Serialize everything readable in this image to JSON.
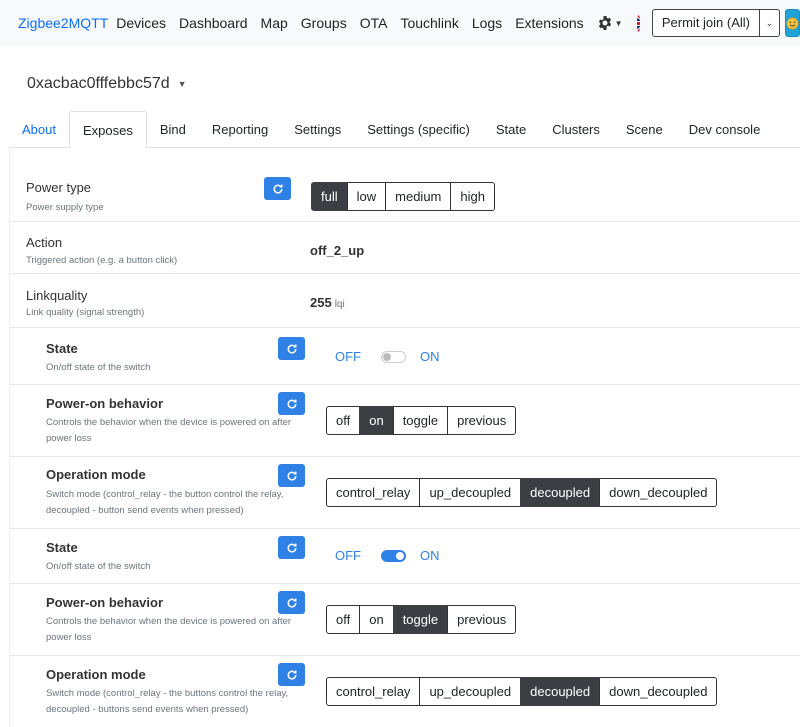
{
  "navbar": {
    "brand": "Zigbee2MQTT",
    "links": [
      "Devices",
      "Dashboard",
      "Map",
      "Groups",
      "OTA",
      "Touchlink",
      "Logs",
      "Extensions"
    ],
    "settings_icon": "gear-icon",
    "language_flag": "uk-flag-icon",
    "permit_join_label": "Permit join (All)",
    "smile_icon": "smile-icon"
  },
  "device": {
    "title": "0xacbac0fffebbc57d"
  },
  "tabs": [
    "About",
    "Exposes",
    "Bind",
    "Reporting",
    "Settings",
    "Settings (specific)",
    "State",
    "Clusters",
    "Scene",
    "Dev console"
  ],
  "active_tab": "Exposes",
  "exposes": {
    "power_type": {
      "label": "Power type",
      "desc": "Power supply type",
      "options": [
        "full",
        "low",
        "medium",
        "high"
      ],
      "selected": "full"
    },
    "action": {
      "label": "Action",
      "desc": "Triggered action (e.g. a button click)",
      "value": "off_2_up"
    },
    "linkquality": {
      "label": "Linkquality",
      "desc": "Link quality (signal strength)",
      "value": "255",
      "unit": "lqi"
    },
    "state_1": {
      "label": "State",
      "desc": "On/off state of the switch",
      "off_text": "OFF",
      "on_text": "ON",
      "on": false
    },
    "power_on_1": {
      "label": "Power-on behavior",
      "desc": "Controls the behavior when the device is powered on after power loss",
      "options": [
        "off",
        "on",
        "toggle",
        "previous"
      ],
      "selected": "on"
    },
    "operation_1": {
      "label": "Operation mode",
      "desc": "Switch mode (control_relay - the button control the relay, decoupled - button send events when pressed)",
      "options": [
        "control_relay",
        "up_decoupled",
        "decoupled",
        "down_decoupled"
      ],
      "selected": "decoupled"
    },
    "state_2": {
      "label": "State",
      "desc": "On/off state of the switch",
      "off_text": "OFF",
      "on_text": "ON",
      "on": true
    },
    "power_on_2": {
      "label": "Power-on behavior",
      "desc": "Controls the behavior when the device is powered on after power loss",
      "options": [
        "off",
        "on",
        "toggle",
        "previous"
      ],
      "selected": "toggle"
    },
    "operation_2": {
      "label": "Operation mode",
      "desc": "Switch mode (control_relay - the buttons control the relay, decoupled - buttons send events when pressed)",
      "options": [
        "control_relay",
        "up_decoupled",
        "decoupled",
        "down_decoupled"
      ],
      "selected": "decoupled"
    }
  },
  "colors": {
    "primary": "#2f81e6",
    "selected_dark": "#3b3f44",
    "link": "#0d6efd"
  }
}
